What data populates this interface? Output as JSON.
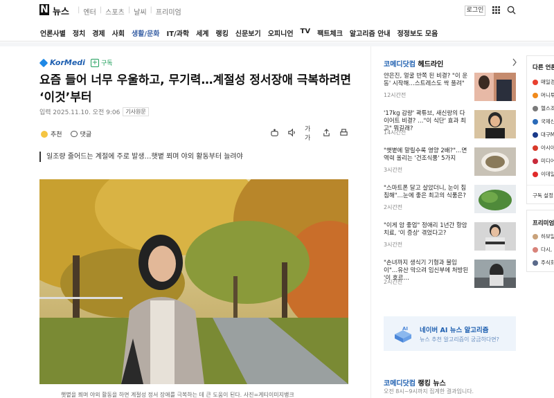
{
  "top": {
    "logo_letter": "N",
    "logo_text": "뉴스",
    "nav": [
      "엔터",
      "스포츠",
      "날씨",
      "프리미엄"
    ],
    "login": "로그인"
  },
  "categories": [
    "언론사별",
    "정치",
    "경제",
    "사회",
    "생활/문화",
    "IT/과학",
    "세계",
    "랭킹",
    "신문보기",
    "오피니언",
    "TV",
    "팩트체크",
    "알고리즘 안내",
    "정정보도 모음"
  ],
  "active_category": "생활/문화",
  "article": {
    "publisher": "KorMedi",
    "subscribe": "구독",
    "headline": "요즘 들어 너무 우울하고, 무기력…계절성 정서장애 극복하려면 ‘이것’부터",
    "date": "입력 2025.11.10. 오전 9:06",
    "original": "기사원문",
    "recommend": "추천",
    "comment": "댓글",
    "text_size": "가가",
    "summary": "일조량 줄어드는 계절에 주로 발생…햇볕 쬐며 야외 활동부터 늘려야",
    "caption": "햇볕을 쬐며 야외 활동을 하면 계절성 정서 장애를 극복하는 데 큰 도움이 된다. 사진=게티이미지뱅크"
  },
  "headlines": {
    "brand": "코메디닷컴",
    "label": "헤드라인",
    "items": [
      {
        "title": "얀은진, 얼굴 반쪽 된 비결? \"이 운동' 시작해…스트레스도 싹 풀려\"",
        "time": "12시간전"
      },
      {
        "title": "'17kg 감량' 곽튜브, 새신랑의 다이어트 비결? …\"이 식단' 효과 최고\" 뭐길래?",
        "time": "14시간전"
      },
      {
        "title": "\"햇볕에 말릴수록 영양 2배?\"…면역력 올리는 '건조식품' 5가지",
        "time": "3시간전"
      },
      {
        "title": "\"스마트폰 달고 살았더니, 눈이 침침해\"…눈에 좋은 최고의 식품은?",
        "time": "2시간전"
      },
      {
        "title": "\"이게 암 좋업\" 정애리 1년간 항암치료, '이 증상' 겪었다고?",
        "time": "3시간전"
      },
      {
        "title": "\"손녀까지 생식기 기형과 불임이\"…유산 막으려 임신부에 처방된 '이 호르…",
        "time": "2시간전"
      }
    ]
  },
  "ai_box": {
    "title": "네이버 AI 뉴스 알고리즘",
    "subtitle": "뉴스 추천 알고리즘이 궁금하다면?"
  },
  "ranking": {
    "brand": "코메디닷컴",
    "label": "랭킹 뉴스",
    "subtitle": "오전 8시~9시까지 집계한 결과입니다."
  },
  "far_panel": {
    "heading": "다른 언론사",
    "items": [
      "매일경제",
      "머니투데이",
      "헬스조선",
      "국제신문",
      "대구MBC",
      "아시아경제",
      "미디어오늘",
      "이데일리"
    ],
    "footer": "구독 설정"
  },
  "far_panel2": {
    "heading": "프리미엄 콘텐츠",
    "items": [
      "하보일기",
      "다시, 봄",
      "주식회사"
    ]
  },
  "colors": {
    "accent": "#3b62a6",
    "brand_blue": "#1e5fb0",
    "subscribe_green": "#1e9e5a"
  }
}
